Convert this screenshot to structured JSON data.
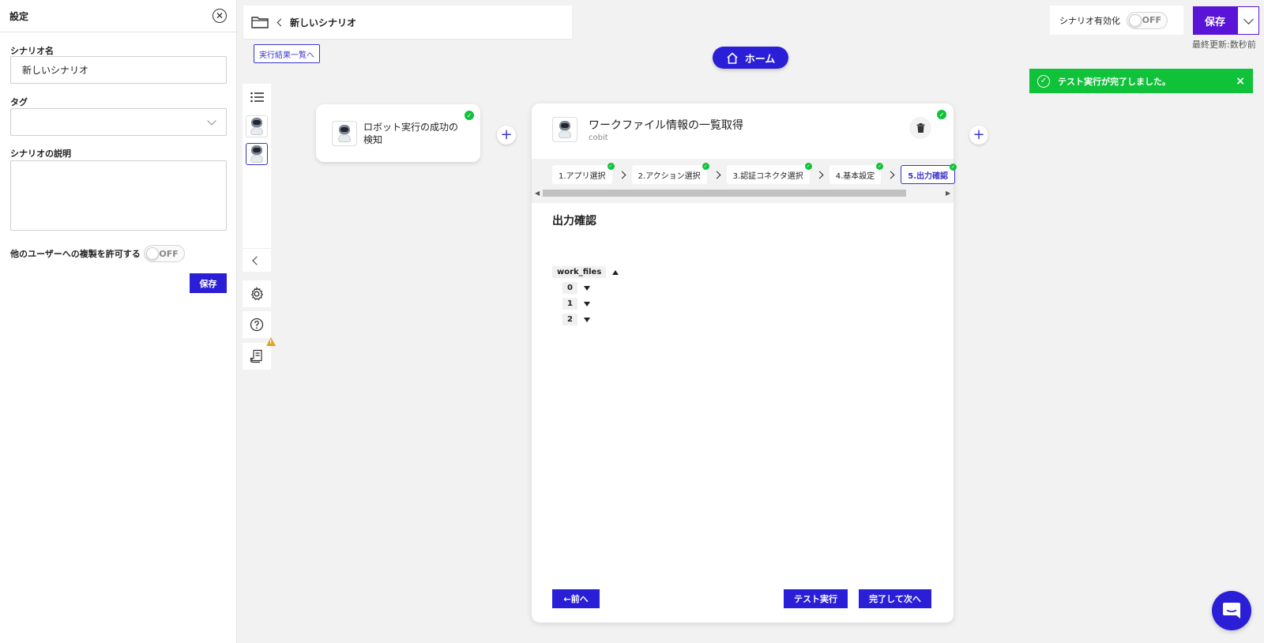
{
  "settings": {
    "title": "設定",
    "name_label": "シナリオ名",
    "name_value": "新しいシナリオ",
    "tag_label": "タグ",
    "desc_label": "シナリオの説明",
    "copy_label": "他のユーザーへの複製を許可する",
    "copy_toggle": "OFF",
    "save_label": "保存"
  },
  "topbar": {
    "scenario_name": "新しいシナリオ",
    "results_link": "実行結果一覧へ"
  },
  "home": {
    "label": "ホーム"
  },
  "enable": {
    "label": "シナリオ有効化",
    "toggle": "OFF"
  },
  "save": {
    "label": "保存",
    "last_updated": "最終更新:数秒前"
  },
  "toast": {
    "message": "テスト実行が完了しました。",
    "close": "×"
  },
  "node1": {
    "title": "ロボット実行の成功の検知"
  },
  "main": {
    "title": "ワークファイル情報の一覧取得",
    "subtitle": "cobit",
    "steps": [
      {
        "label": "1.アプリ選択"
      },
      {
        "label": "2.アクション選択"
      },
      {
        "label": "3.認証コネクタ選択"
      },
      {
        "label": "4.基本設定"
      },
      {
        "label": "5.出力確認"
      }
    ],
    "output_title": "出力確認",
    "tree": {
      "root": "work_files",
      "items": [
        "0",
        "1",
        "2"
      ]
    },
    "prev_label": "←前へ",
    "test_label": "テスト実行",
    "next_label": "完了して次へ"
  },
  "colors": {
    "primary": "#2a1fd6",
    "save_purple": "#5a14d8",
    "success": "#10c23a",
    "warning": "#e0a320"
  }
}
